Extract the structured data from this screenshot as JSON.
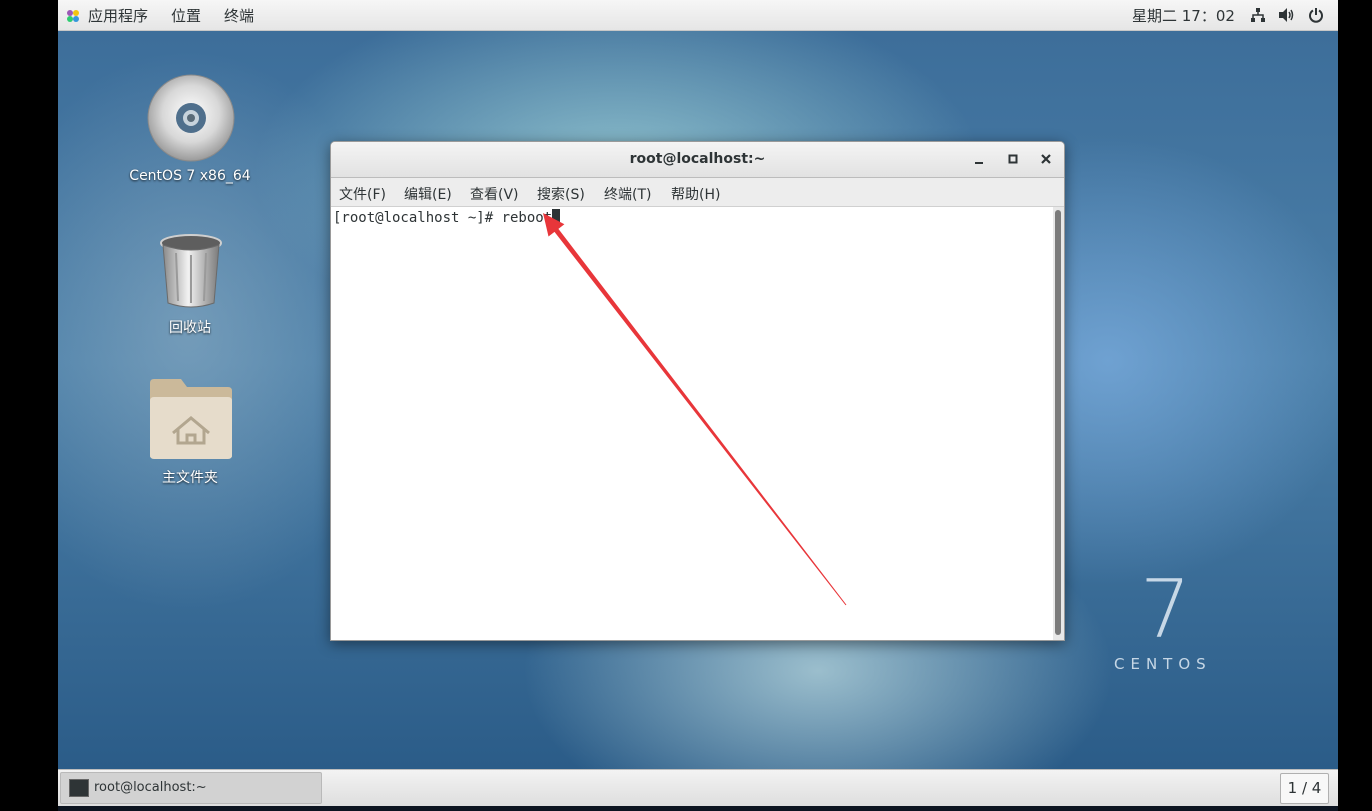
{
  "topbar": {
    "applications": "应用程序",
    "places": "位置",
    "terminal": "终端",
    "clock": "星期二 17：02"
  },
  "desktop": {
    "icons": [
      {
        "label": "CentOS 7 x86_64",
        "icon": "cd-disc-icon"
      },
      {
        "label": "回收站",
        "icon": "trash-icon"
      },
      {
        "label": "主文件夹",
        "icon": "home-folder-icon"
      }
    ],
    "brand_number": "7",
    "brand_word": "CENTOS"
  },
  "terminal": {
    "title": "root@localhost:~",
    "menu": [
      "文件(F)",
      "编辑(E)",
      "查看(V)",
      "搜索(S)",
      "终端(T)",
      "帮助(H)"
    ],
    "prompt": "[root@localhost ~]# reboot"
  },
  "taskbar": {
    "window_label": "root@localhost:~",
    "workspace": "1 / 4"
  },
  "colors": {
    "arrow": "#e8363a",
    "panel": "#ececec"
  }
}
